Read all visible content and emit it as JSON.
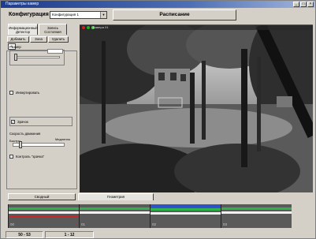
{
  "window": {
    "title": "Параметры камер"
  },
  "config": {
    "label": "Конфигурация",
    "selected": "Конфигурация 1",
    "schedule_button": "Расписание"
  },
  "left_panel": {
    "tabs": [
      {
        "label": "Информационный Детектор"
      },
      {
        "label": "Запись Состояния"
      }
    ],
    "buttons": {
      "add": "Добавить",
      "edit": "Зона",
      "delete": "Удалить"
    },
    "small_value": "1",
    "range_label": "Размер",
    "invert_label": "Инвертировать",
    "zoom_label": "Зрачок",
    "speed_label": "Скорость движения",
    "fast_label": "Быстро",
    "medium_label": "Медленно",
    "mirror_label": "Контроль \"зрачка\"",
    "range_level": 0.05,
    "speed_level": 0.12,
    "zoom_checked": true
  },
  "camera": {
    "name": "Камера 01",
    "colors": {
      "dot_red": "#d02020",
      "dot_green": "#20b020",
      "dot_green2": "#50d050"
    }
  },
  "bottom_tabs": {
    "summary": "Сводный",
    "geometry": "Геометрия"
  },
  "timeline": {
    "segments": [
      {
        "label": "00",
        "mark": "1"
      },
      {
        "label": "01",
        "mark": ""
      },
      {
        "label": "02",
        "mark": ""
      },
      {
        "label": "03",
        "mark": "2"
      }
    ],
    "colors": {
      "green": "#2db34a",
      "white": "#f0f0f0",
      "red": "#c82828",
      "blue": "#3050c8"
    }
  },
  "status": {
    "left": "50 - 53",
    "right": "1 - 12"
  }
}
